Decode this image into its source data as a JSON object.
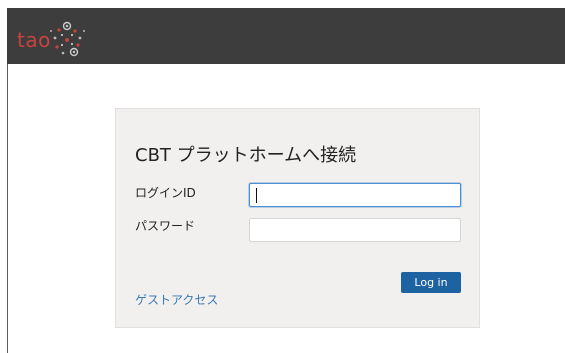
{
  "header": {
    "logo_text": "tao",
    "logo_color": "#c6443d",
    "background": "#3d3d3d"
  },
  "login_form": {
    "title": "CBT プラットホームへ接続",
    "login_label": "ログインID",
    "login_value": "",
    "password_label": "パスワード",
    "password_value": "",
    "login_button": "Log in",
    "guest_link": "ゲストアクセス",
    "accent_color": "#1e63a1",
    "link_color": "#3a79b4"
  }
}
